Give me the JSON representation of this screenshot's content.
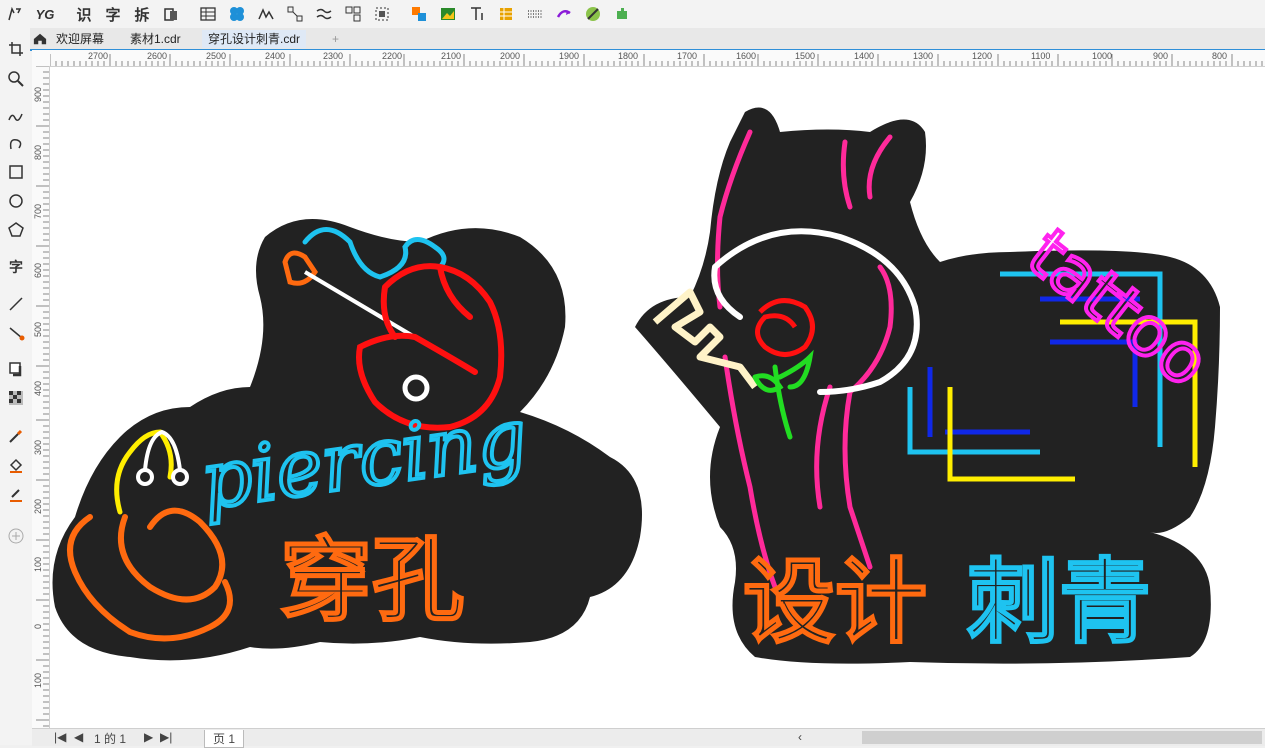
{
  "toolbar": {
    "text_tools": [
      "识",
      "字",
      "拆"
    ],
    "icons": [
      "shape-tool-icon",
      "ygfont-icon",
      "recognize-text-icon",
      "font-icon",
      "split-icon",
      "clipboard-icon",
      "table-icon",
      "pattern-icon",
      "trace-icon",
      "node-icon",
      "wave-icon",
      "group-icon",
      "select-icon",
      "color-swap-icon",
      "image-icon",
      "text-frame-icon",
      "grid-icon",
      "dots-icon",
      "redo-icon",
      "gradient-icon",
      "plugin-icon"
    ]
  },
  "tabs": [
    {
      "label": "欢迎屏幕"
    },
    {
      "label": "素材1.cdr"
    },
    {
      "label": "穿孔设计刺青.cdr"
    }
  ],
  "ruler": {
    "h_ticks": [
      "2700",
      "2600",
      "2500",
      "2400",
      "2300",
      "2200",
      "2100",
      "2000",
      "1900",
      "1800",
      "1700",
      "1600",
      "1500",
      "1400",
      "1300",
      "1200",
      "1100",
      "1000",
      "900",
      "800"
    ],
    "v_ticks": [
      "900",
      "800",
      "700",
      "600",
      "500",
      "400",
      "300",
      "200",
      "100",
      "0",
      "100"
    ]
  },
  "canvas": {
    "left_art": {
      "script_text": "piercing",
      "title": "穿孔"
    },
    "right_art": {
      "script_text": "tattoo",
      "title_orange": "设计",
      "title_blue": "刺青"
    }
  },
  "status": {
    "page_info": "1 的 1",
    "page_tab": "页 1"
  },
  "colors": {
    "sign_bg": "#222222",
    "neon_blue": "#1ec3f0",
    "neon_orange": "#ff6a10",
    "neon_red": "#ff1010",
    "neon_pink": "#ff2a9a",
    "neon_magenta": "#ff22ee",
    "neon_yellow": "#ffee00",
    "neon_green": "#22dd22",
    "accent": "#2f8fd8"
  }
}
